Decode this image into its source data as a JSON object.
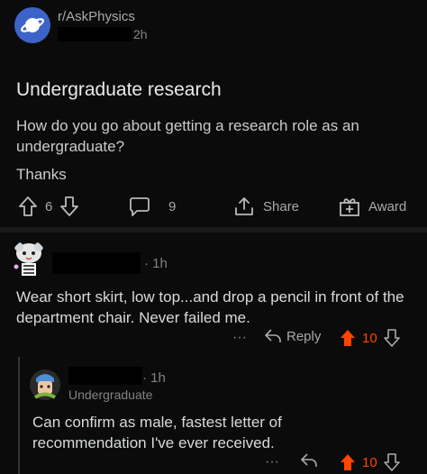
{
  "post": {
    "subreddit": "r/AskPhysics",
    "age": "2h",
    "title": "Undergraduate research",
    "body": "How do you go about getting a research role as an undergraduate?",
    "thanks": "Thanks",
    "votes": "6",
    "comments": "9",
    "share_label": "Share",
    "award_label": "Award"
  },
  "comments": [
    {
      "age": "· 1h",
      "text": "Wear short skirt, low top...and drop a pencil in front of the department chair. Never failed me.",
      "more": "···",
      "reply_label": "Reply",
      "votes": "10"
    },
    {
      "age": "· 1h",
      "flair": "Undergraduate",
      "text": "Can confirm as male, fastest letter of recommendation I've ever received.",
      "more": "···",
      "votes": "10"
    }
  ],
  "colors": {
    "upvoted": "#ff4500",
    "subreddit_avatar": "#3c63c8",
    "background": "#0b0b0b"
  },
  "icons": [
    "planet-icon",
    "upvote-icon",
    "downvote-icon",
    "comment-icon",
    "share-icon",
    "award-icon",
    "more-icon",
    "reply-icon"
  ]
}
